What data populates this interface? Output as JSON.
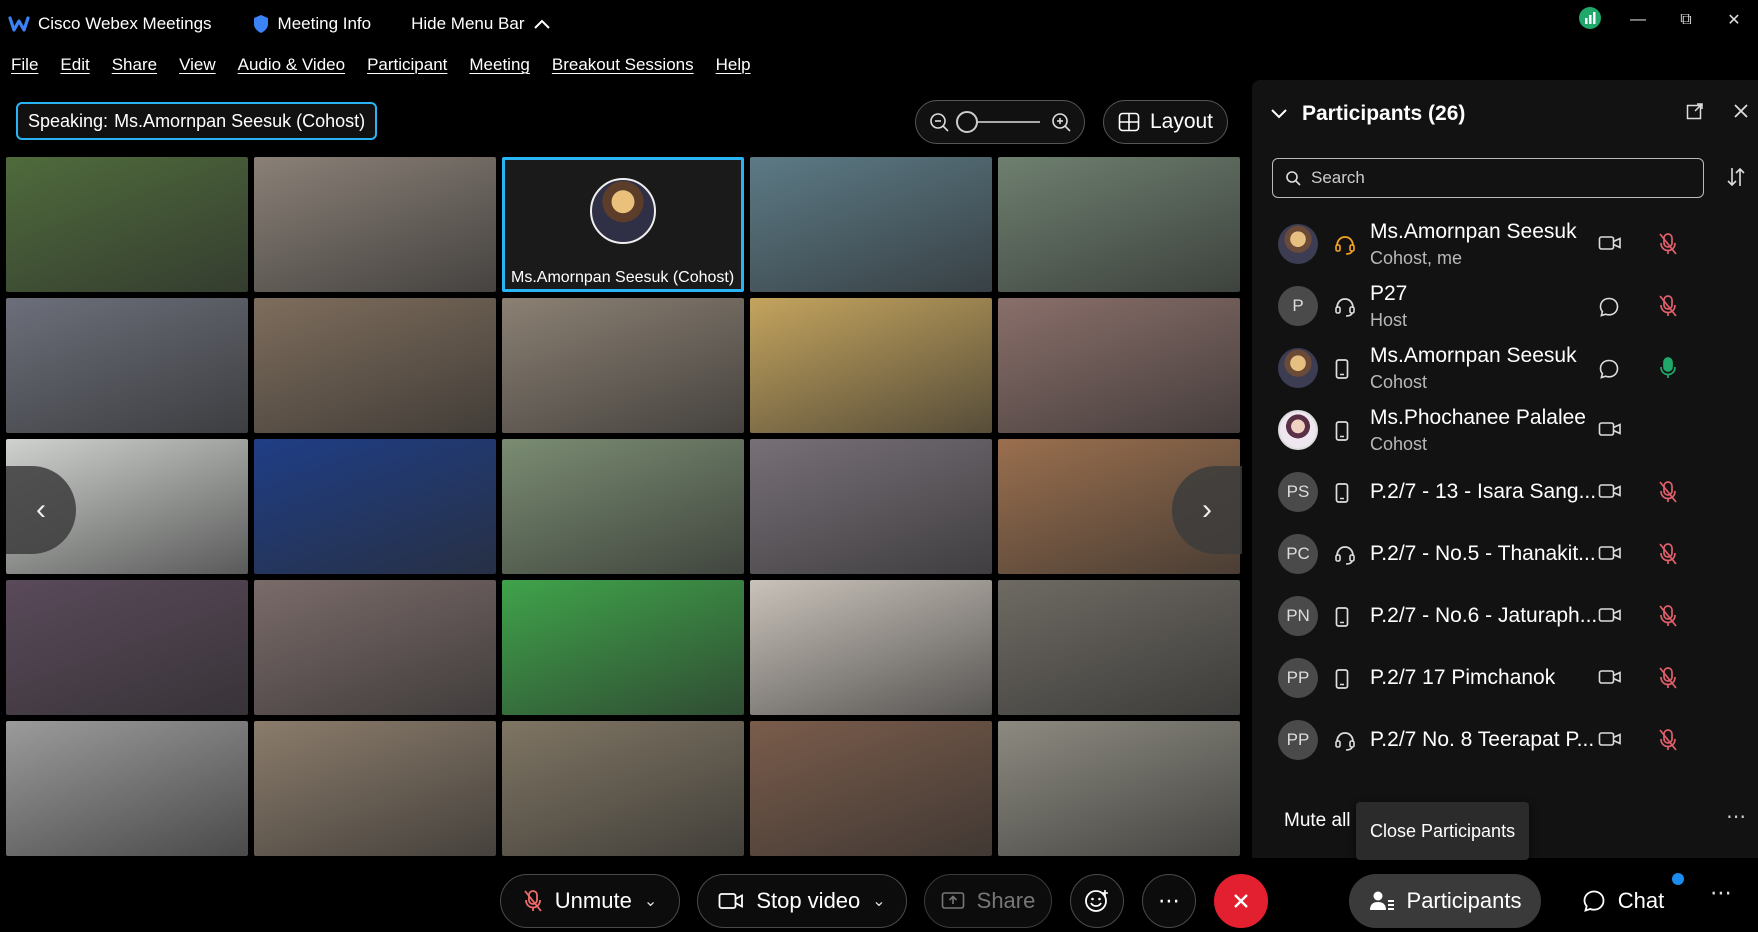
{
  "titlebar": {
    "app_name": "Cisco Webex Meetings",
    "meeting_info": "Meeting Info",
    "hide_menu_bar": "Hide Menu Bar"
  },
  "menu": [
    "File",
    "Edit",
    "Share",
    "View",
    "Audio & Video",
    "Participant",
    "Meeting",
    "Breakout Sessions",
    "Help"
  ],
  "toolbar": {
    "speaking_label": "Speaking:",
    "speaking_name": "Ms.Amornpan Seesuk (Cohost)",
    "layout_label": "Layout"
  },
  "video_grid": {
    "active_tile_name": "Ms.Amornpan Seesuk  (Cohost)",
    "tile_colors": [
      "#4f6b3c",
      "#8a8077",
      "#1a1a1a",
      "#5c7a86",
      "#6e7f6f",
      "#6c6f7a",
      "#7e6d5c",
      "#8b8073",
      "#c4a45e",
      "#8a6f6a",
      "#cfd2cf",
      "#1f3e86",
      "#7a8c72",
      "#777077",
      "#9a6f4e",
      "#5a4a5a",
      "#7a6b69",
      "#3fa34a",
      "#c9c2ba",
      "#6e6a63",
      "#9b9b9b",
      "#8b7c6b",
      "#7f7563",
      "#7a5c4b",
      "#8c8a80"
    ]
  },
  "participants_panel": {
    "title": "Participants (26)",
    "search_placeholder": "Search",
    "mute_all": "Mute all",
    "list": [
      {
        "name": "Ms.Amornpan Seesuk",
        "role": "Cohost, me",
        "initials": "",
        "avatar": "photo",
        "device": "headset",
        "video": true,
        "mic": "muted"
      },
      {
        "name": "P27",
        "role": "Host",
        "initials": "P",
        "avatar": "initials",
        "device": "headset",
        "video": false,
        "mic": "muted"
      },
      {
        "name": "Ms.Amornpan Seesuk",
        "role": "Cohost",
        "initials": "",
        "avatar": "photo",
        "device": "mobile",
        "video": false,
        "mic": "active"
      },
      {
        "name": "Ms.Phochanee Palalee",
        "role": "Cohost",
        "initials": "",
        "avatar": "photo2",
        "device": "mobile",
        "video": true,
        "mic": "none"
      },
      {
        "name": "P.2/7 - 13 - Isara Sang...",
        "role": "",
        "initials": "PS",
        "avatar": "initials",
        "device": "mobile",
        "video": true,
        "mic": "muted"
      },
      {
        "name": "P.2/7 - No.5 - Thanakit...",
        "role": "",
        "initials": "PC",
        "avatar": "initials",
        "device": "headset",
        "video": true,
        "mic": "muted"
      },
      {
        "name": "P.2/7 - No.6 - Jaturaph...",
        "role": "",
        "initials": "PN",
        "avatar": "initials",
        "device": "mobile",
        "video": true,
        "mic": "muted"
      },
      {
        "name": "P.2/7 17 Pimchanok",
        "role": "",
        "initials": "PP",
        "avatar": "initials",
        "device": "mobile",
        "video": true,
        "mic": "muted"
      },
      {
        "name": "P.2/7 No. 8 Teerapat P...",
        "role": "",
        "initials": "PP",
        "avatar": "initials",
        "device": "headset",
        "video": true,
        "mic": "muted"
      }
    ]
  },
  "tooltip": "Close Participants",
  "controls": {
    "unmute": "Unmute",
    "stop_video": "Stop video",
    "share": "Share",
    "participants": "Participants",
    "chat": "Chat",
    "end_color": "#e3202f"
  }
}
